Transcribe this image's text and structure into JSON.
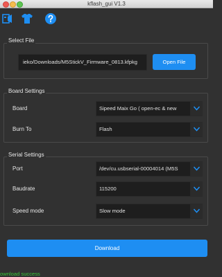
{
  "window": {
    "title": "kflash_gui V1.3"
  },
  "toolbar": {
    "icons": [
      "plugin-icon",
      "tshirt-icon",
      "help-icon"
    ]
  },
  "select_file": {
    "group_title": "Select File",
    "path": "ieko/Downloads/M5StickV_Firmware_0813.kfpkg",
    "open_button": "Open File"
  },
  "board_settings": {
    "group_title": "Board Settings",
    "board_label": "Board",
    "board_value": "Sipeed Maix Go ( open-ec & new",
    "burn_to_label": "Burn To",
    "burn_to_value": "Flash"
  },
  "serial_settings": {
    "group_title": "Serial Settings",
    "port_label": "Port",
    "port_value": "/dev/cu.usbserial-00004014 (M5S",
    "baudrate_label": "Baudrate",
    "baudrate_value": "115200",
    "speed_label": "Speed mode",
    "speed_value": "Slow mode"
  },
  "download_button": "Download",
  "status_text": "ownload success",
  "colors": {
    "accent": "#1e8ef2",
    "success": "#39c639",
    "background": "#313131"
  }
}
